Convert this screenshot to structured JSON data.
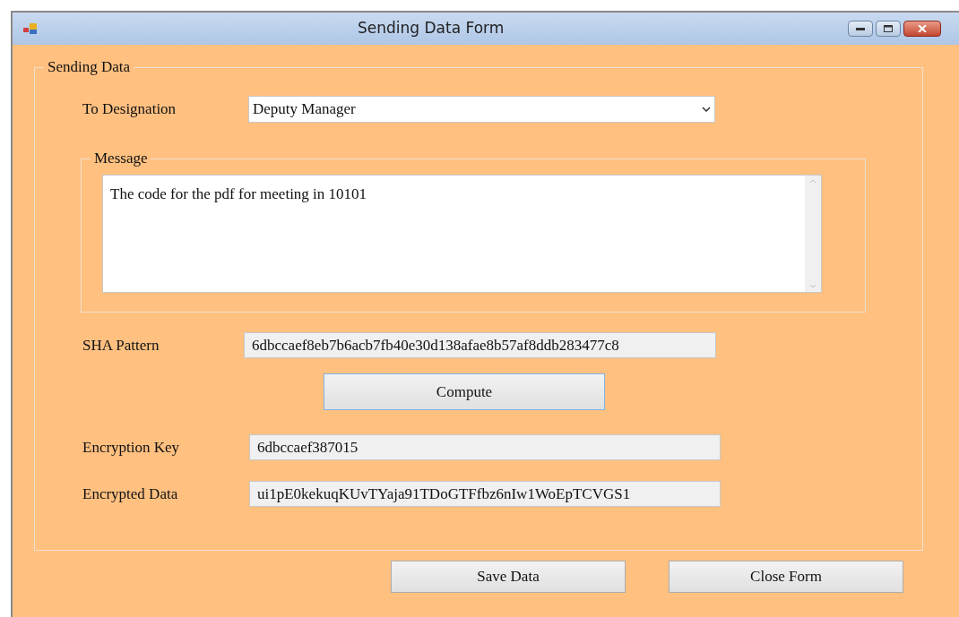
{
  "window": {
    "title": "Sending Data Form"
  },
  "group": {
    "title": "Sending Data"
  },
  "designation": {
    "label": "To Designation",
    "value": "Deputy Manager"
  },
  "message": {
    "title": "Message",
    "value": "The code for the pdf for meeting in 10101"
  },
  "sha": {
    "label": "SHA Pattern",
    "value": "6dbccaef8eb7b6acb7fb40e30d138afae8b57af8ddb283477c8",
    "read_only": true
  },
  "compute_button": "Compute",
  "encryption_key": {
    "label": "Encryption Key",
    "value": "6dbccaef387015",
    "read_only": true
  },
  "encrypted_data": {
    "label": "Encrypted Data",
    "value": "ui1pE0kekuqKUvTYaja91TDoGTFfbz6nIw1WoEpTCVGS1",
    "read_only": true
  },
  "buttons": [
    "Save Data",
    "Close Form"
  ]
}
